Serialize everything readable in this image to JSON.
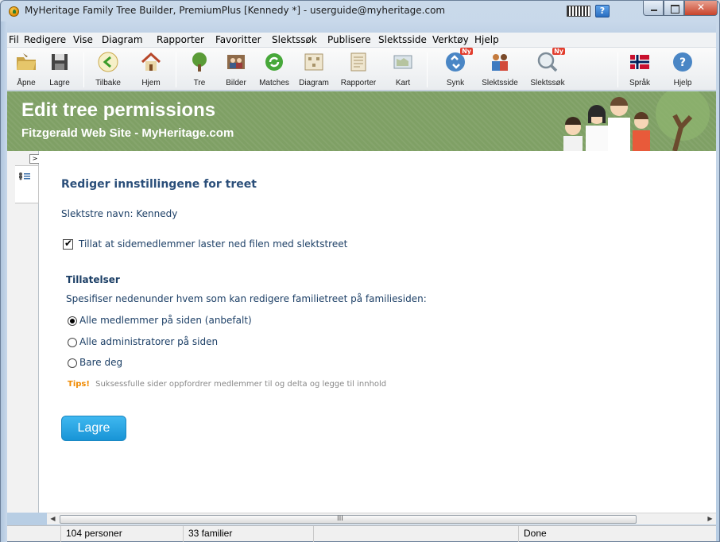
{
  "window": {
    "title": "MyHeritage Family Tree Builder, PremiumPlus [Kennedy *] - userguide@myheritage.com"
  },
  "menu": {
    "items": [
      "Fil",
      "Redigere",
      "Vise",
      "Diagram",
      "Rapporter",
      "Favoritter",
      "Slektssøk",
      "Publisere",
      "Slektsside",
      "Verktøy",
      "Hjelp"
    ]
  },
  "toolbar": {
    "items": [
      {
        "label": "Åpne",
        "icon": "folder-icon"
      },
      {
        "label": "Lagre",
        "icon": "floppy-disk-icon"
      },
      {
        "label": "Tilbake",
        "icon": "back-arrow-icon"
      },
      {
        "label": "Hjem",
        "icon": "home-icon"
      },
      {
        "label": "Tre",
        "icon": "tree-icon"
      },
      {
        "label": "Bilder",
        "icon": "photos-icon"
      },
      {
        "label": "Matches",
        "icon": "matches-icon"
      },
      {
        "label": "Diagram",
        "icon": "diagram-icon"
      },
      {
        "label": "Rapporter",
        "icon": "reports-icon"
      },
      {
        "label": "Kart",
        "icon": "map-icon"
      },
      {
        "label": "Synk",
        "icon": "sync-icon",
        "badge": "Ny"
      },
      {
        "label": "Slektsside",
        "icon": "family-site-icon"
      },
      {
        "label": "Slektssøk",
        "icon": "family-search-icon",
        "badge": "Ny"
      },
      {
        "label": "Språk",
        "icon": "language-flag-icon"
      },
      {
        "label": "Hjelp",
        "icon": "help-icon"
      }
    ]
  },
  "banner": {
    "title": "Edit tree permissions",
    "subtitle": "Fitzgerald Web Site - MyHeritage.com"
  },
  "form": {
    "heading": "Rediger innstillingene for treet",
    "tree_name": "Slektstre navn: Kennedy",
    "allow_download_label": "Tillat at sidemedlemmer laster ned filen med slektstreet",
    "allow_download_checked": true,
    "permissions_heading": "Tillatelser",
    "permissions_desc": "Spesifiser nedenunder hvem som kan redigere familietreet på familiesiden:",
    "options": [
      {
        "label": "Alle medlemmer på siden (anbefalt)",
        "selected": true
      },
      {
        "label": "Alle administratorer på siden",
        "selected": false
      },
      {
        "label": "Bare deg",
        "selected": false
      }
    ],
    "tips_label": "Tips!",
    "tips_text": "Suksessfulle sider oppfordrer medlemmer til og delta og legge til innhold",
    "save_label": "Lagre"
  },
  "scrollbar": {
    "grip": "III"
  },
  "status": {
    "persons": "104 personer",
    "families": "33 familier",
    "state": "Done"
  },
  "colors": {
    "banner_green": "#7fa065",
    "heading_blue": "#2b4f7a",
    "tips_orange": "#f08a00",
    "save_button": "#1894d6"
  }
}
